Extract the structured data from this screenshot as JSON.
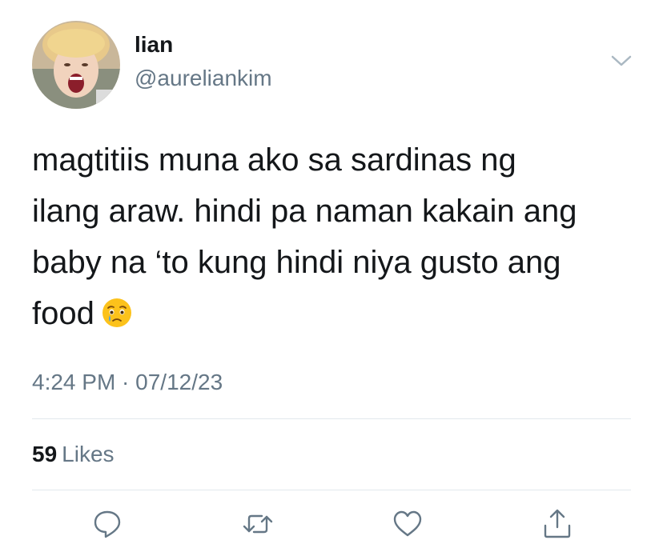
{
  "author": {
    "display_name": "lian",
    "handle": "@aureliankim"
  },
  "tweet": {
    "lines": [
      "magtitiis muna ako sa sardinas ng",
      "ilang araw. hindi pa naman kakain ang",
      "baby na ‘to kung hindi niya gusto ang",
      "food"
    ],
    "emoji": "face-holding-back-tears",
    "timestamp": "4:24 PM · 07/12/23"
  },
  "stats": {
    "likes_count": "59",
    "likes_label": "Likes"
  },
  "actions": [
    {
      "name": "reply",
      "icon": "speech-bubble-icon"
    },
    {
      "name": "retweet",
      "icon": "retweet-arrows-icon"
    },
    {
      "name": "like",
      "icon": "heart-icon"
    },
    {
      "name": "share",
      "icon": "share-upload-icon"
    }
  ],
  "colors": {
    "text_primary": "#14171a",
    "text_secondary": "#657786",
    "divider": "#e1e8ed"
  }
}
